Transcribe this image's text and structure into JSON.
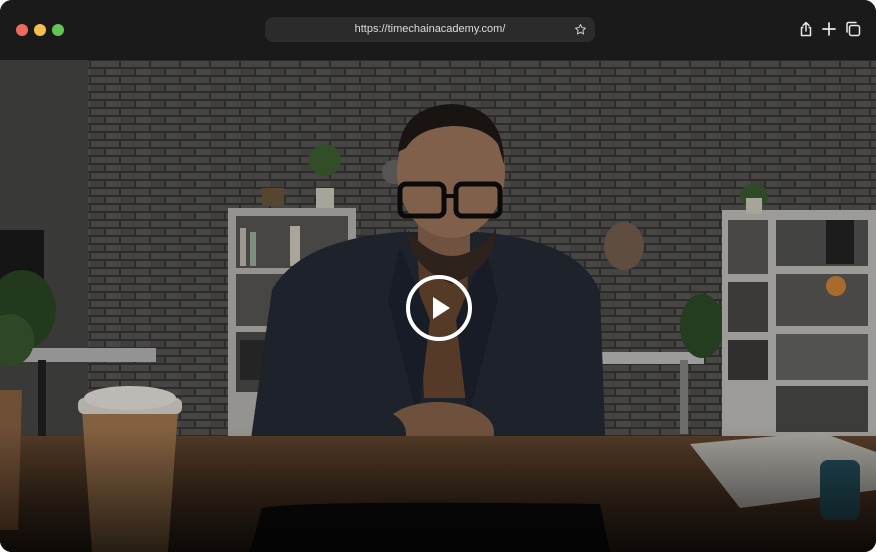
{
  "browser": {
    "url": "https://timechainacademy.com/",
    "icons": [
      "close-button",
      "minimize-button",
      "zoom-button",
      "bookmark-star-icon",
      "share-icon",
      "new-tab-icon",
      "tab-overview-icon"
    ]
  },
  "video": {
    "state": "paused",
    "play_icon": "play-icon"
  },
  "colors": {
    "titlebar": "#1a1a1a",
    "urlbar": "#2b2b2b",
    "close": "#ec6a5e",
    "minimize": "#f4bf4f",
    "zoom": "#61c554"
  }
}
